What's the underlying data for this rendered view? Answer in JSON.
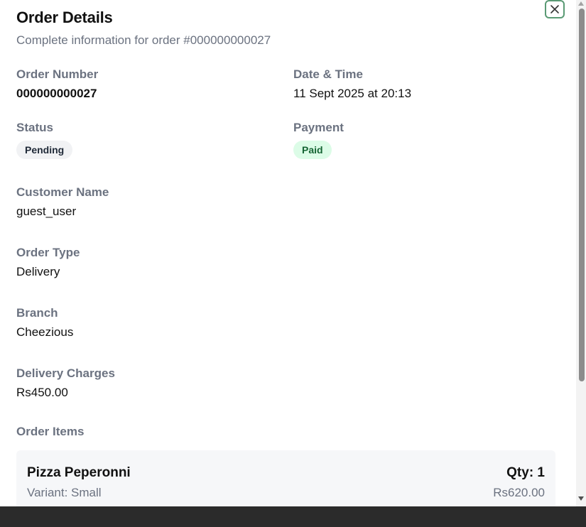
{
  "dialog": {
    "title": "Order Details",
    "subtitle": "Complete information for order #000000000027",
    "close_icon": "close-icon"
  },
  "fields": {
    "order_number": {
      "label": "Order Number",
      "value": "000000000027"
    },
    "date_time": {
      "label": "Date & Time",
      "value": "11 Sept 2025 at 20:13"
    },
    "status": {
      "label": "Status",
      "value": "Pending"
    },
    "payment": {
      "label": "Payment",
      "value": "Paid"
    },
    "customer_name": {
      "label": "Customer Name",
      "value": "guest_user"
    },
    "order_type": {
      "label": "Order Type",
      "value": "Delivery"
    },
    "branch": {
      "label": "Branch",
      "value": "Cheezious"
    },
    "delivery_charges": {
      "label": "Delivery Charges",
      "value": "Rs450.00"
    }
  },
  "order_items": {
    "label": "Order Items",
    "items": [
      {
        "name": "Pizza Peperonni",
        "qty": "Qty: 1",
        "variant": "Variant: Small",
        "price": "Rs620.00"
      }
    ]
  },
  "colors": {
    "close_border": "#5a9a74",
    "payment_badge_bg": "#dcfce7",
    "payment_badge_text": "#166534",
    "status_badge_bg": "#f1f2f4",
    "label_gray": "#6b7280"
  }
}
